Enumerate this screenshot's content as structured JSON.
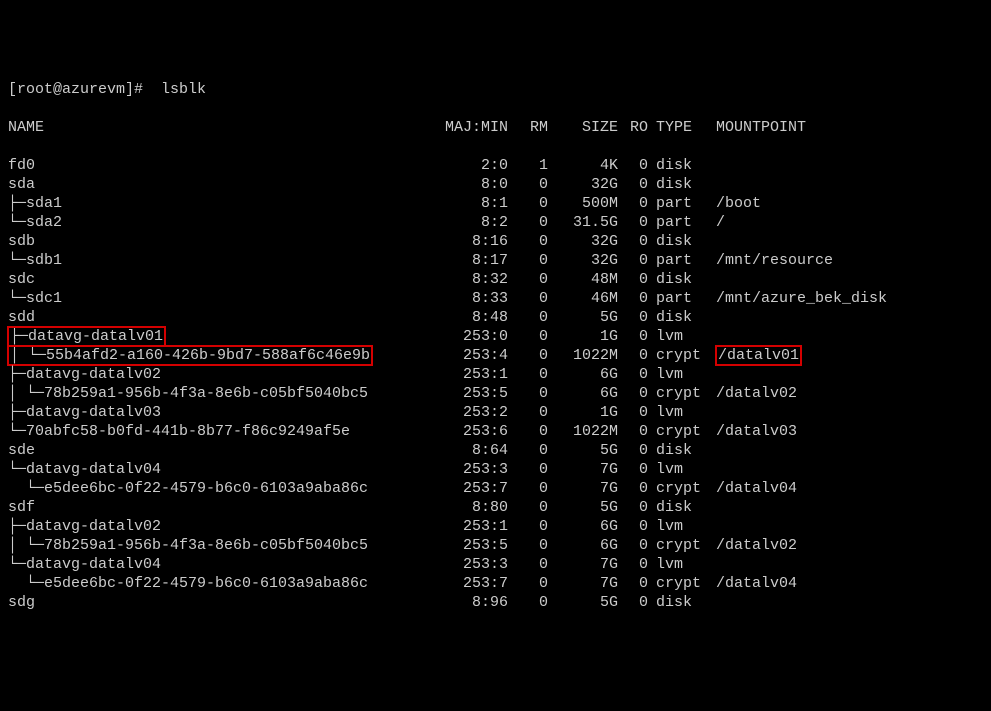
{
  "prompt": "[root@azurevm]#  lsblk",
  "headers": {
    "name": "NAME",
    "majmin": "MAJ:MIN",
    "rm": "RM",
    "size": "SIZE",
    "ro": "RO",
    "type": "TYPE",
    "mount": "MOUNTPOINT"
  },
  "rows": [
    {
      "name": "fd0",
      "majmin": "2:0",
      "rm": "1",
      "size": "4K",
      "ro": "0",
      "type": "disk",
      "mount": ""
    },
    {
      "name": "sda",
      "majmin": "8:0",
      "rm": "0",
      "size": "32G",
      "ro": "0",
      "type": "disk",
      "mount": ""
    },
    {
      "name": "├─sda1",
      "majmin": "8:1",
      "rm": "0",
      "size": "500M",
      "ro": "0",
      "type": "part",
      "mount": "/boot"
    },
    {
      "name": "└─sda2",
      "majmin": "8:2",
      "rm": "0",
      "size": "31.5G",
      "ro": "0",
      "type": "part",
      "mount": "/"
    },
    {
      "name": "sdb",
      "majmin": "8:16",
      "rm": "0",
      "size": "32G",
      "ro": "0",
      "type": "disk",
      "mount": ""
    },
    {
      "name": "└─sdb1",
      "majmin": "8:17",
      "rm": "0",
      "size": "32G",
      "ro": "0",
      "type": "part",
      "mount": "/mnt/resource"
    },
    {
      "name": "sdc",
      "majmin": "8:32",
      "rm": "0",
      "size": "48M",
      "ro": "0",
      "type": "disk",
      "mount": ""
    },
    {
      "name": "└─sdc1",
      "majmin": "8:33",
      "rm": "0",
      "size": "46M",
      "ro": "0",
      "type": "part",
      "mount": "/mnt/azure_bek_disk"
    },
    {
      "name": "sdd",
      "majmin": "8:48",
      "rm": "0",
      "size": "5G",
      "ro": "0",
      "type": "disk",
      "mount": ""
    },
    {
      "name": "├─datavg-datalv01",
      "majmin": "253:0",
      "rm": "0",
      "size": "1G",
      "ro": "0",
      "type": "lvm",
      "mount": "",
      "hlName": true
    },
    {
      "name": "│ └─55b4afd2-a160-426b-9bd7-588af6c46e9b",
      "majmin": "253:4",
      "rm": "0",
      "size": "1022M",
      "ro": "0",
      "type": "crypt",
      "mount": "/datalv01",
      "hlName": true,
      "hlMount": true
    },
    {
      "name": "├─datavg-datalv02",
      "majmin": "253:1",
      "rm": "0",
      "size": "6G",
      "ro": "0",
      "type": "lvm",
      "mount": ""
    },
    {
      "name": "│ └─78b259a1-956b-4f3a-8e6b-c05bf5040bc5",
      "majmin": "253:5",
      "rm": "0",
      "size": "6G",
      "ro": "0",
      "type": "crypt",
      "mount": "/datalv02"
    },
    {
      "name": "├─datavg-datalv03",
      "majmin": "253:2",
      "rm": "0",
      "size": "1G",
      "ro": "0",
      "type": "lvm",
      "mount": ""
    },
    {
      "name": "└─70abfc58-b0fd-441b-8b77-f86c9249af5e",
      "majmin": "253:6",
      "rm": "0",
      "size": "1022M",
      "ro": "0",
      "type": "crypt",
      "mount": "/datalv03"
    },
    {
      "name": "sde",
      "majmin": "8:64",
      "rm": "0",
      "size": "5G",
      "ro": "0",
      "type": "disk",
      "mount": ""
    },
    {
      "name": "└─datavg-datalv04",
      "majmin": "253:3",
      "rm": "0",
      "size": "7G",
      "ro": "0",
      "type": "lvm",
      "mount": ""
    },
    {
      "name": "  └─e5dee6bc-0f22-4579-b6c0-6103a9aba86c",
      "majmin": "253:7",
      "rm": "0",
      "size": "7G",
      "ro": "0",
      "type": "crypt",
      "mount": "/datalv04"
    },
    {
      "name": "sdf",
      "majmin": "8:80",
      "rm": "0",
      "size": "5G",
      "ro": "0",
      "type": "disk",
      "mount": ""
    },
    {
      "name": "├─datavg-datalv02",
      "majmin": "253:1",
      "rm": "0",
      "size": "6G",
      "ro": "0",
      "type": "lvm",
      "mount": ""
    },
    {
      "name": "│ └─78b259a1-956b-4f3a-8e6b-c05bf5040bc5",
      "majmin": "253:5",
      "rm": "0",
      "size": "6G",
      "ro": "0",
      "type": "crypt",
      "mount": "/datalv02"
    },
    {
      "name": "└─datavg-datalv04",
      "majmin": "253:3",
      "rm": "0",
      "size": "7G",
      "ro": "0",
      "type": "lvm",
      "mount": ""
    },
    {
      "name": "  └─e5dee6bc-0f22-4579-b6c0-6103a9aba86c",
      "majmin": "253:7",
      "rm": "0",
      "size": "7G",
      "ro": "0",
      "type": "crypt",
      "mount": "/datalv04"
    },
    {
      "name": "sdg",
      "majmin": "8:96",
      "rm": "0",
      "size": "5G",
      "ro": "0",
      "type": "disk",
      "mount": ""
    }
  ]
}
